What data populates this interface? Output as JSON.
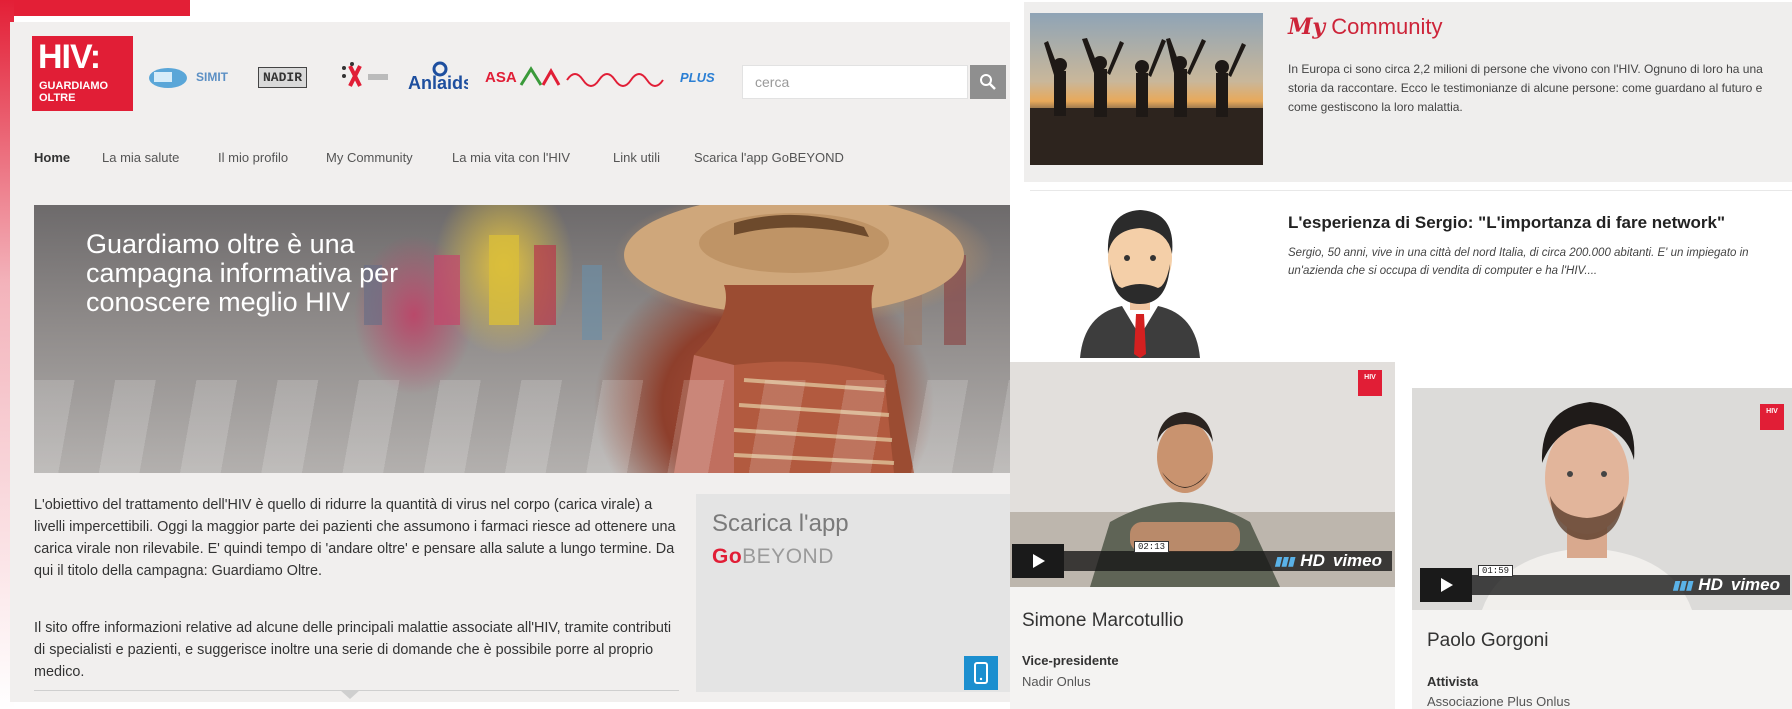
{
  "site": {
    "logo": {
      "big": "HIV:",
      "line1": "GUARDIAMO",
      "line2": "OLTRE"
    },
    "partners": [
      "SIMIT",
      "NADIR",
      "ASA",
      "PLUS"
    ],
    "search": {
      "placeholder": "cerca"
    }
  },
  "nav": {
    "items": [
      "Home",
      "La mia salute",
      "Il mio profilo",
      "My Community",
      "La mia vita con l'HIV",
      "Link utili",
      "Scarica l'app GoBEYOND"
    ]
  },
  "hero": {
    "text": "Guardiamo oltre è una campagna informativa per conoscere meglio HIV"
  },
  "intro": {
    "p1": "L'obiettivo del trattamento dell'HIV è quello di ridurre la quantità di virus nel corpo (carica virale) a livelli impercettibili. Oggi la maggior parte dei pazienti che assumono i farmaci riesce ad ottenere una carica virale non rilevabile. E' quindi tempo di 'andare oltre' e pensare alla salute a lungo termine. Da qui il titolo della campagna: Guardiamo Oltre.",
    "p2": "Il sito offre informazioni relative ad alcune delle principali malattie associate all'HIV, tramite contributi di specialisti e pazienti, e suggerisce inoltre una serie di domande che è possibile porre al proprio medico."
  },
  "promo": {
    "title": "Scarica l'app",
    "brand_go": "Go",
    "brand_rest": "BEYOND"
  },
  "community": {
    "title_my": "My",
    "title_rest": " Community",
    "description": "In Europa ci sono circa 2,2 milioni di persone che vivono con l'HIV. Ognuno di loro ha una storia da raccontare. Ecco le testimonianze di alcune persone: come guardano al futuro e come gestiscono la loro malattia."
  },
  "story": {
    "title": "L'esperienza di Sergio: \"L'importanza di fare network\"",
    "excerpt": "Sergio, 50 anni, vive in una città del nord Italia, di circa 200.000 abitanti. E' un impiegato in un'azienda che si occupa di vendita di computer e ha l'HIV...."
  },
  "videos": [
    {
      "time": "02:13",
      "quality": "HD",
      "brand": "vimeo",
      "name": "Simone Marcotullio",
      "role": "Vice-presidente",
      "org": "Nadir Onlus"
    },
    {
      "time": "01:59",
      "quality": "HD",
      "brand": "vimeo",
      "name": "Paolo Gorgoni",
      "role": "Attivista",
      "org": "Associazione Plus Onlus"
    }
  ],
  "colors": {
    "brand_red": "#e11e36",
    "search_button": "#8f8f8f",
    "app_button": "#1c8fcf"
  }
}
